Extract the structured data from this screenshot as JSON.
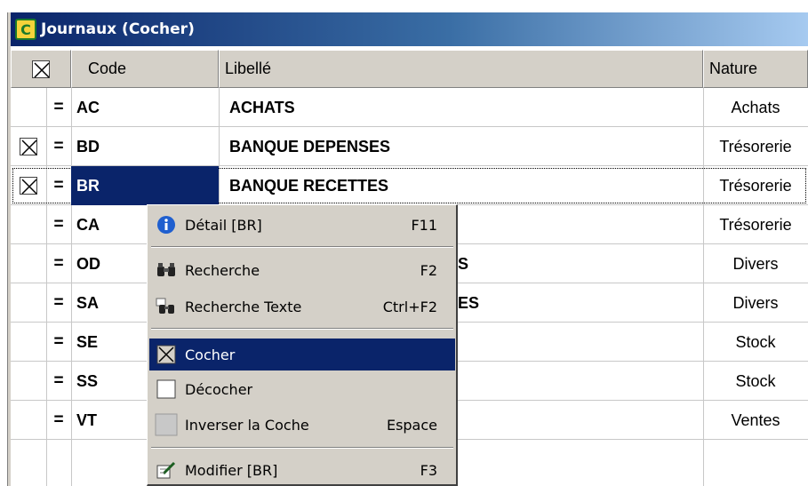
{
  "window": {
    "title": "Journaux (Cocher)",
    "app_icon_letter": "C"
  },
  "columns": {
    "code": "Code",
    "libelle": "Libellé",
    "nature": "Nature"
  },
  "rows": [
    {
      "checked": false,
      "code": "AC",
      "libelle": "ACHATS",
      "nature": "Achats"
    },
    {
      "checked": true,
      "code": "BD",
      "libelle": "BANQUE DEPENSES",
      "nature": "Trésorerie"
    },
    {
      "checked": true,
      "code": "BR",
      "libelle": "BANQUE RECETTES",
      "nature": "Trésorerie"
    },
    {
      "checked": false,
      "code": "CA",
      "libelle": "",
      "nature": "Trésorerie"
    },
    {
      "checked": false,
      "code": "OD",
      "libelle": "S",
      "nature": "Divers"
    },
    {
      "checked": false,
      "code": "SA",
      "libelle": "ES",
      "nature": "Divers"
    },
    {
      "checked": false,
      "code": "SE",
      "libelle": "",
      "nature": "Stock"
    },
    {
      "checked": false,
      "code": "SS",
      "libelle": "",
      "nature": "Stock"
    },
    {
      "checked": false,
      "code": "VT",
      "libelle": "",
      "nature": "Ventes"
    }
  ],
  "eq_symbol": "=",
  "context_menu": {
    "detail": {
      "label": "Détail [BR]",
      "shortcut": "F11",
      "icon": "info-icon"
    },
    "recherche": {
      "label": "Recherche",
      "shortcut": "F2",
      "icon": "binoculars-icon"
    },
    "recherche_texte": {
      "label": "Recherche Texte",
      "shortcut": "Ctrl+F2",
      "icon": "text-search-icon"
    },
    "cocher": {
      "label": "Cocher",
      "shortcut": "",
      "icon": "checked-box-icon",
      "selected": true
    },
    "decocher": {
      "label": "Décocher",
      "shortcut": "",
      "icon": "empty-box-icon"
    },
    "inverser": {
      "label": "Inverser la Coche",
      "shortcut": "Espace",
      "icon": "gray-box-icon"
    },
    "modifier": {
      "label": "Modifier [BR]",
      "shortcut": "F3",
      "icon": "edit-icon"
    }
  },
  "colors": {
    "title_start": "#0a246a",
    "title_end": "#a6caf0",
    "selection": "#0a246a",
    "chrome": "#d4d0c8"
  }
}
